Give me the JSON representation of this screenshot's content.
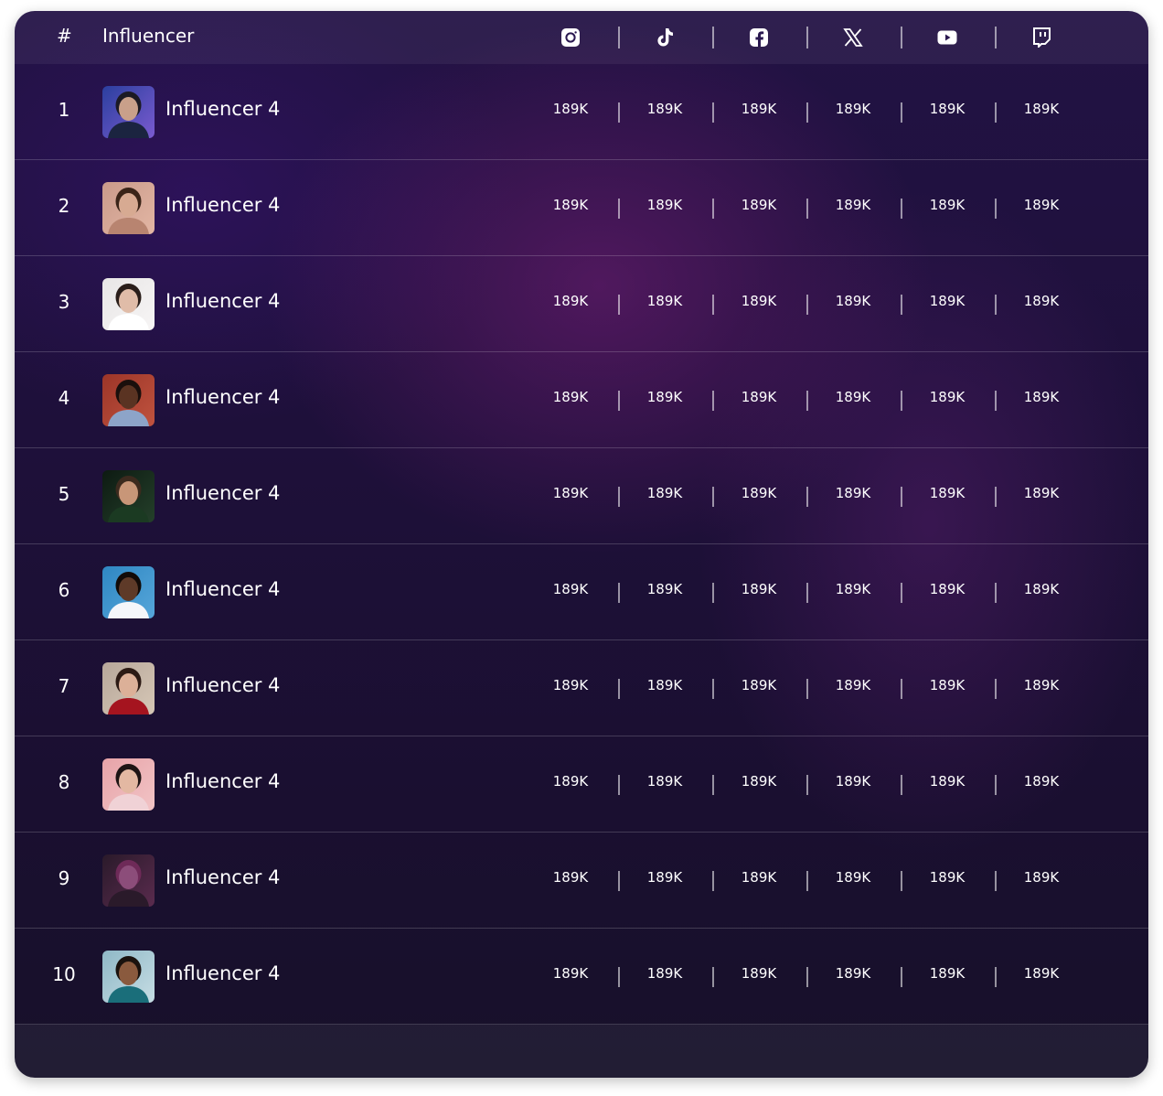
{
  "table": {
    "header": {
      "rank_label": "#",
      "name_label": "Influencer",
      "platforms": [
        {
          "name": "instagram",
          "icon": "instagram-icon"
        },
        {
          "name": "tiktok",
          "icon": "tiktok-icon"
        },
        {
          "name": "facebook",
          "icon": "facebook-icon"
        },
        {
          "name": "x",
          "icon": "x-icon"
        },
        {
          "name": "youtube",
          "icon": "youtube-icon"
        },
        {
          "name": "twitch",
          "icon": "twitch-icon"
        }
      ]
    },
    "rows": [
      {
        "rank": "1",
        "name": "Influencer 4",
        "avatar": "avatar-photo",
        "stats": [
          "189K",
          "189K",
          "189K",
          "189K",
          "189K",
          "189K"
        ]
      },
      {
        "rank": "2",
        "name": "Influencer 4",
        "avatar": "avatar-photo",
        "stats": [
          "189K",
          "189K",
          "189K",
          "189K",
          "189K",
          "189K"
        ]
      },
      {
        "rank": "3",
        "name": "Influencer 4",
        "avatar": "avatar-photo",
        "stats": [
          "189K",
          "189K",
          "189K",
          "189K",
          "189K",
          "189K"
        ]
      },
      {
        "rank": "4",
        "name": "Influencer 4",
        "avatar": "avatar-photo",
        "stats": [
          "189K",
          "189K",
          "189K",
          "189K",
          "189K",
          "189K"
        ]
      },
      {
        "rank": "5",
        "name": "Influencer 4",
        "avatar": "avatar-photo",
        "stats": [
          "189K",
          "189K",
          "189K",
          "189K",
          "189K",
          "189K"
        ]
      },
      {
        "rank": "6",
        "name": "Influencer 4",
        "avatar": "avatar-photo",
        "stats": [
          "189K",
          "189K",
          "189K",
          "189K",
          "189K",
          "189K"
        ]
      },
      {
        "rank": "7",
        "name": "Influencer 4",
        "avatar": "avatar-photo",
        "stats": [
          "189K",
          "189K",
          "189K",
          "189K",
          "189K",
          "189K"
        ]
      },
      {
        "rank": "8",
        "name": "Influencer 4",
        "avatar": "avatar-photo",
        "stats": [
          "189K",
          "189K",
          "189K",
          "189K",
          "189K",
          "189K"
        ]
      },
      {
        "rank": "9",
        "name": "Influencer 4",
        "avatar": "avatar-photo",
        "stats": [
          "189K",
          "189K",
          "189K",
          "189K",
          "189K",
          "189K"
        ]
      },
      {
        "rank": "10",
        "name": "Influencer 4",
        "avatar": "avatar-photo",
        "stats": [
          "189K",
          "189K",
          "189K",
          "189K",
          "189K",
          "189K"
        ]
      }
    ]
  },
  "colors": {
    "text": "#ffffff",
    "background_top": "#221244",
    "background_bottom": "#17112a",
    "accent_glow": "#6b1f74",
    "divider": "#ffffff2e"
  }
}
